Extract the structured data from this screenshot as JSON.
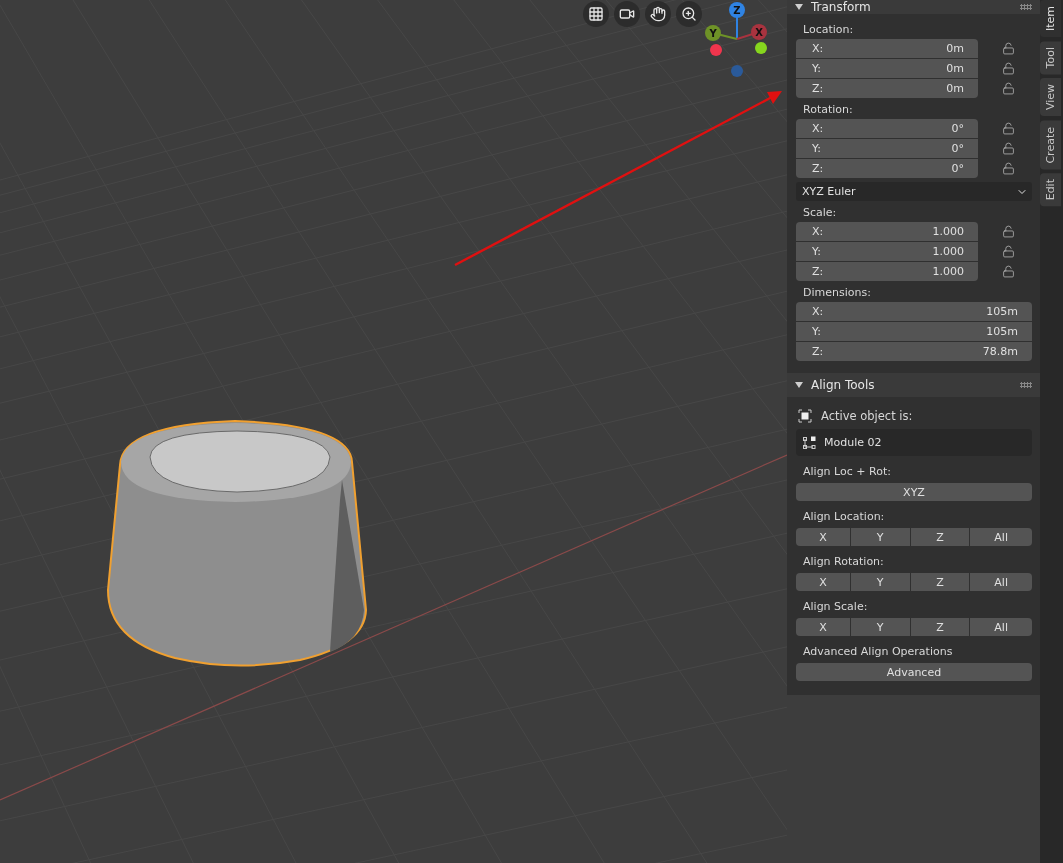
{
  "viewport": {
    "gizmo_axes": [
      {
        "label": "Z",
        "color": "#2f83e3"
      },
      {
        "label": "Y",
        "color": "#6e9227"
      },
      {
        "label": "X",
        "color": "#a8333f"
      }
    ]
  },
  "sidebar_tabs": [
    {
      "label": "Item",
      "selected": true
    },
    {
      "label": "Tool",
      "selected": false
    },
    {
      "label": "View",
      "selected": false
    },
    {
      "label": "Create",
      "selected": false
    },
    {
      "label": "Edit",
      "selected": false
    }
  ],
  "transform": {
    "title": "Transform",
    "expanded": true,
    "groups": [
      {
        "kind": "fields",
        "label": "Location:",
        "fields": [
          {
            "axis": "X:",
            "value": "0m",
            "locked": false
          },
          {
            "axis": "Y:",
            "value": "0m",
            "locked": false
          },
          {
            "axis": "Z:",
            "value": "0m",
            "locked": false
          }
        ]
      },
      {
        "kind": "fields",
        "label": "Rotation:",
        "fields": [
          {
            "axis": "X:",
            "value": "0°",
            "locked": false
          },
          {
            "axis": "Y:",
            "value": "0°",
            "locked": false
          },
          {
            "axis": "Z:",
            "value": "0°",
            "locked": false
          }
        ]
      },
      {
        "kind": "dropdown",
        "value": "XYZ Euler"
      },
      {
        "kind": "fields",
        "label": "Scale:",
        "fields": [
          {
            "axis": "X:",
            "value": "1.000",
            "locked": false
          },
          {
            "axis": "Y:",
            "value": "1.000",
            "locked": false
          },
          {
            "axis": "Z:",
            "value": "1.000",
            "locked": false
          }
        ]
      },
      {
        "kind": "fields",
        "label": "Dimensions:",
        "fields": [
          {
            "axis": "X:",
            "value": "105m"
          },
          {
            "axis": "Y:",
            "value": "105m"
          },
          {
            "axis": "Z:",
            "value": "78.8m"
          }
        ]
      }
    ]
  },
  "align_tools": {
    "title": "Align Tools",
    "expanded": true,
    "active_label": "Active object is:",
    "active_object": "Module 02",
    "sections": [
      {
        "label": "Align Loc + Rot:",
        "buttons": [
          "XYZ"
        ]
      },
      {
        "label": "Align Location:",
        "buttons": [
          "X",
          "Y",
          "Z",
          "All"
        ]
      },
      {
        "label": "Align Rotation:",
        "buttons": [
          "X",
          "Y",
          "Z",
          "All"
        ]
      },
      {
        "label": "Align Scale:",
        "buttons": [
          "X",
          "Y",
          "Z",
          "All"
        ]
      },
      {
        "label": "Advanced Align Operations",
        "buttons": [
          "Advanced"
        ]
      }
    ]
  }
}
